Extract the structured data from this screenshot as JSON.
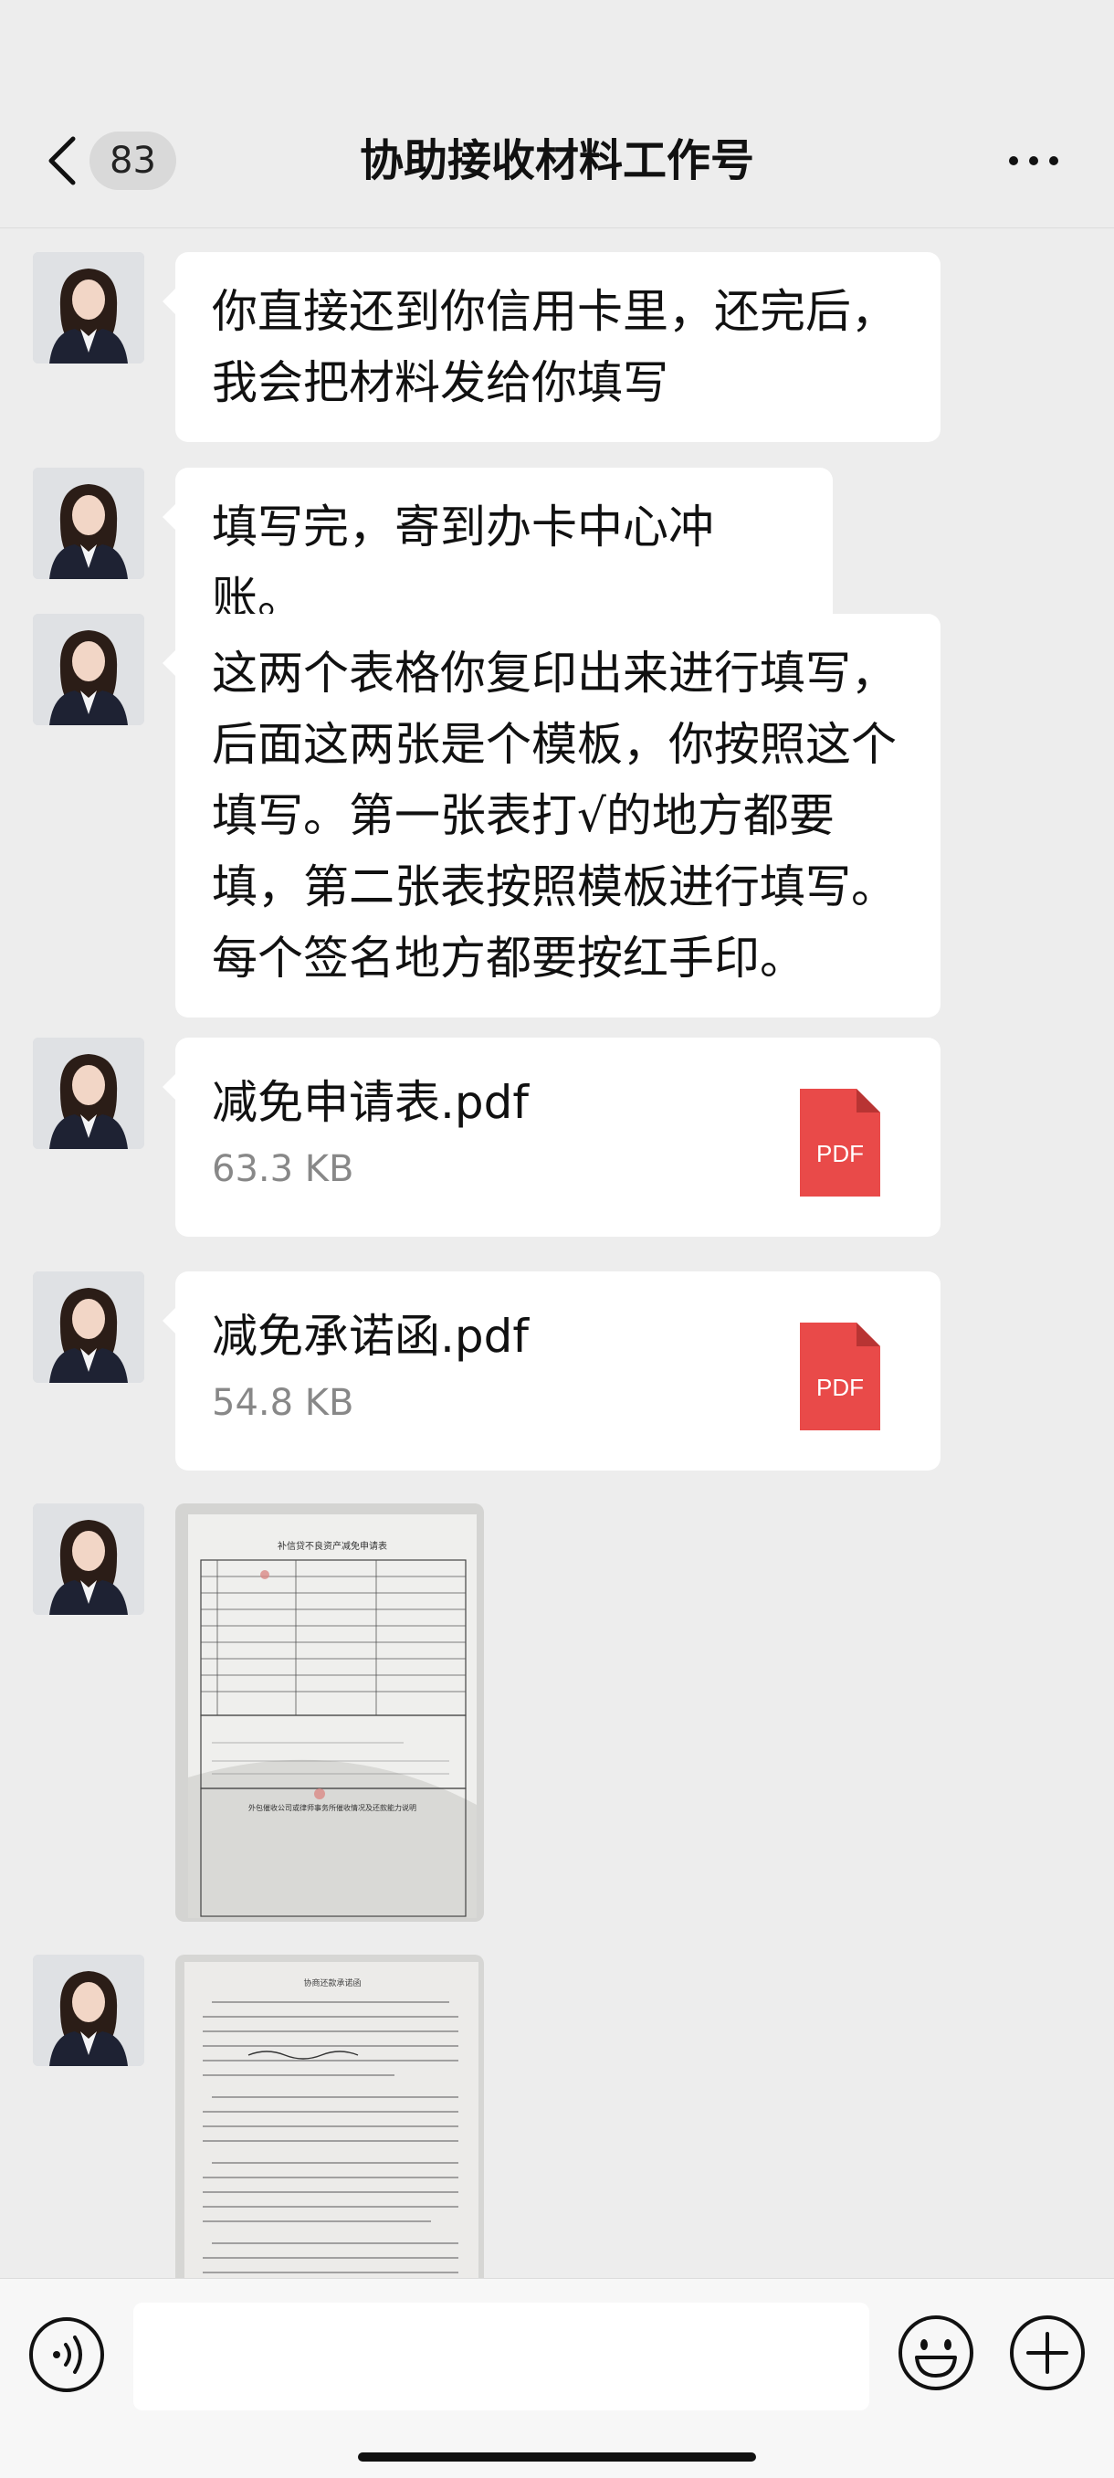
{
  "header": {
    "unread_count": "83",
    "title": "协助接收材料工作号"
  },
  "messages": [
    {
      "type": "text",
      "text": "你直接还到你信用卡里，还完后，我会把材料发给你填写"
    },
    {
      "type": "text",
      "text": "填写完，寄到办卡中心冲账。"
    },
    {
      "type": "text",
      "text": "这两个表格你复印出来进行填写，后面这两张是个模板，你按照这个填写。第一张表打√的地方都要填，第二张表按照模板进行填写。每个签名地方都要按红手印。"
    },
    {
      "type": "file",
      "name": "减免申请表.pdf",
      "size": "63.3 KB",
      "icon_label": "PDF"
    },
    {
      "type": "file",
      "name": "减免承诺函.pdf",
      "size": "54.8 KB",
      "icon_label": "PDF"
    },
    {
      "type": "image",
      "doc_title": "补信贷不良资产减免申请表",
      "subtitle": "外包催收公司或律师事务所催收情况及还款能力说明"
    },
    {
      "type": "image",
      "doc_title": "协商还款承诺函"
    }
  ],
  "colors": {
    "background": "#ededed",
    "bubble": "#ffffff",
    "pdf_red": "#e94a49",
    "secondary_text": "#888888"
  },
  "icons": [
    "back-chevron-icon",
    "more-icon",
    "voice-icon",
    "emoji-icon",
    "plus-icon",
    "pdf-icon"
  ]
}
